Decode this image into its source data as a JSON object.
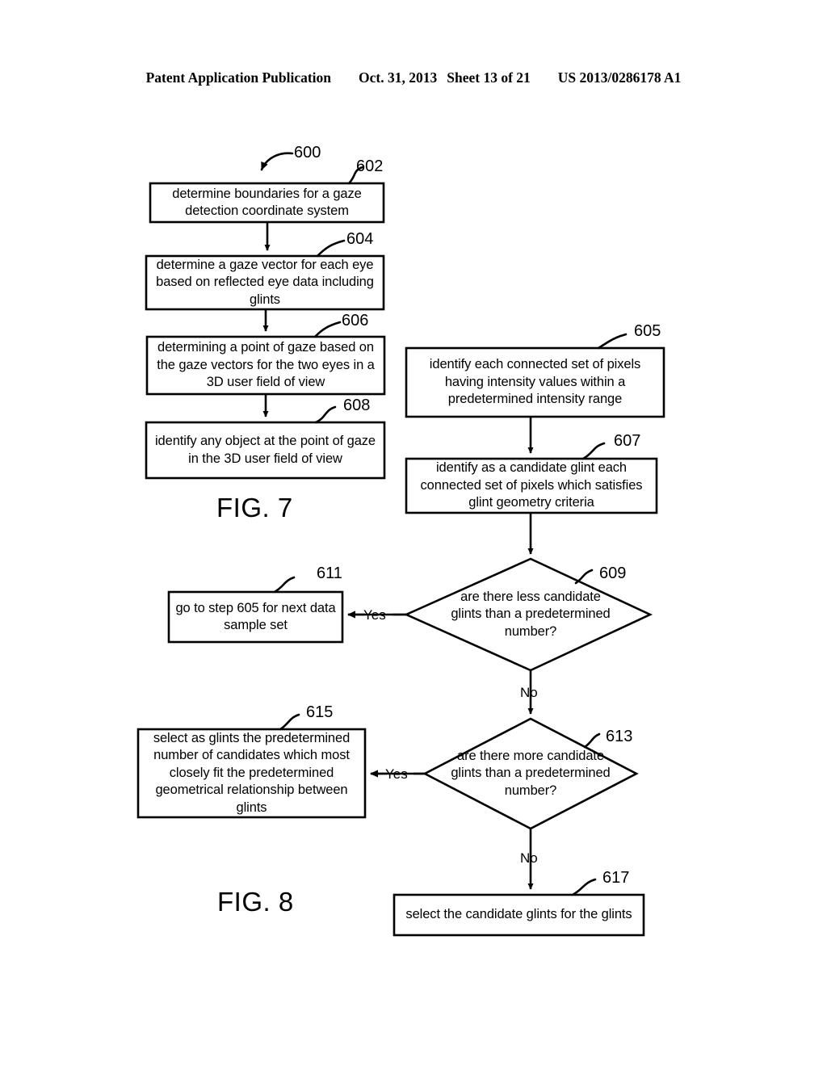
{
  "header": {
    "publication": "Patent Application Publication",
    "date": "Oct. 31, 2013",
    "sheet": "Sheet 13 of 21",
    "patent_number": "US 2013/0286178 A1"
  },
  "figures": [
    {
      "id": "fig7",
      "label": "FIG. 7"
    },
    {
      "id": "fig8",
      "label": "FIG. 8"
    }
  ],
  "diagram": {
    "nodes": [
      {
        "id": "n600",
        "ref": "600",
        "type": "pointer",
        "text": ""
      },
      {
        "id": "n602",
        "ref": "602",
        "type": "process",
        "text": "determine boundaries for a gaze detection coordinate system"
      },
      {
        "id": "n604",
        "ref": "604",
        "type": "process",
        "text": "determine a gaze vector for each eye based on reflected eye data including glints"
      },
      {
        "id": "n606",
        "ref": "606",
        "type": "process",
        "text": "determining a point of gaze based on the gaze vectors for the two eyes in a 3D user field of view"
      },
      {
        "id": "n608",
        "ref": "608",
        "type": "process",
        "text": "identify any object at the point of gaze in the 3D user field of view"
      },
      {
        "id": "n605",
        "ref": "605",
        "type": "process",
        "text": "identify each connected set of pixels having intensity values within a predetermined intensity range"
      },
      {
        "id": "n607",
        "ref": "607",
        "type": "process",
        "text": "identify as a candidate glint each connected set of pixels which satisfies glint geometry criteria"
      },
      {
        "id": "n609",
        "ref": "609",
        "type": "decision",
        "text": "are there less candidate glints than a predetermined number?"
      },
      {
        "id": "n611",
        "ref": "611",
        "type": "process",
        "text": "go to step 605 for next data sample set"
      },
      {
        "id": "n613",
        "ref": "613",
        "type": "decision",
        "text": "are there more candidate glints than a predetermined number?"
      },
      {
        "id": "n615",
        "ref": "615",
        "type": "process",
        "text": "select as glints the predetermined number of candidates which most closely fit the predetermined geometrical relationship between glints"
      },
      {
        "id": "n617",
        "ref": "617",
        "type": "process",
        "text": "select the candidate glints for the glints"
      }
    ],
    "edge_labels": {
      "yes_609": "Yes",
      "no_609": "No",
      "yes_613": "Yes",
      "no_613": "No"
    }
  },
  "colors": {
    "ink": "#000000",
    "page": "#ffffff"
  }
}
